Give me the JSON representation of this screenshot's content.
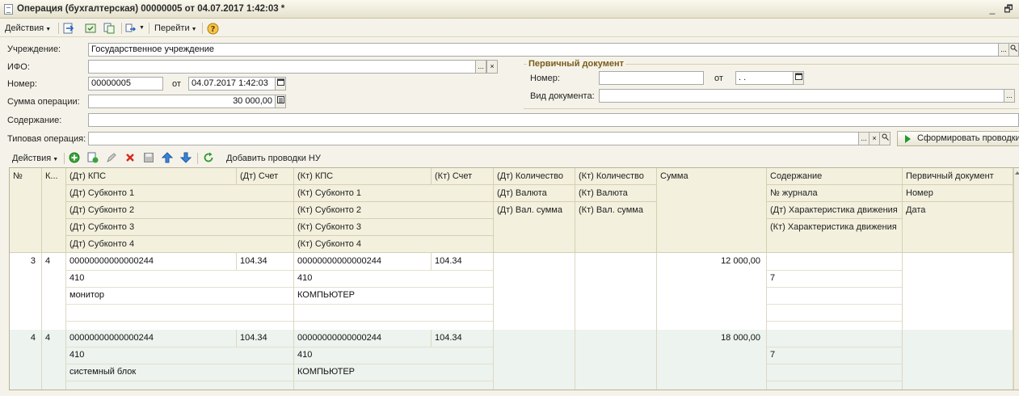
{
  "window": {
    "title": "Операция (бухгалтерская) 00000005 от 04.07.2017 1:42:03 *",
    "minimize": "_",
    "restore": "🗗"
  },
  "toolbar": {
    "actions": "Действия",
    "goto": "Перейти",
    "help": "?"
  },
  "form": {
    "institution_label": "Учреждение:",
    "institution_value": "Государственное учреждение",
    "ifo_label": "ИФО:",
    "number_label": "Номер:",
    "number_value": "00000005",
    "date_label": "от",
    "date_value": "04.07.2017  1:42:03",
    "sum_label": "Сумма операции:",
    "sum_value": "30 000,00",
    "content_label": "Содержание:",
    "typical_label": "Типовая операция:",
    "build_button": "Сформировать проводки",
    "ellipsis": "...",
    "clear": "×",
    "search": "🔍"
  },
  "primary_doc": {
    "title": "Первичный документ",
    "number_label": "Номер:",
    "date_label": "от",
    "date_value": " .  .",
    "doctype_label": "Вид документа:"
  },
  "grid_toolbar": {
    "actions": "Действия",
    "add_nu": "Добавить проводки НУ"
  },
  "table": {
    "headers": {
      "num": "№",
      "k": "К...",
      "dt_kps": "(Дт) КПС",
      "dt_account": "(Дт) Счет",
      "kt_kps": "(Кт) КПС",
      "kt_account": "(Кт) Счет",
      "dt_qty": "(Дт) Количество",
      "kt_qty": "(Кт) Количество",
      "sum": "Сумма",
      "content": "Содержание",
      "primary": "Первичный документ",
      "dt_sub1": "(Дт) Субконто 1",
      "kt_sub1": "(Кт) Субконто 1",
      "dt_cur": "(Дт) Валюта",
      "kt_cur": "(Кт) Валюта",
      "journal": "№ журнала",
      "prim_num": "Номер",
      "dt_sub2": "(Дт) Субконто 2",
      "kt_sub2": "(Кт) Субконто 2",
      "dt_valsum": "(Дт) Вал. сумма",
      "kt_valsum": "(Кт) Вал. сумма",
      "dt_char": "(Дт) Характеристика движения",
      "prim_date": "Дата",
      "dt_sub3": "(Дт) Субконто 3",
      "kt_sub3": "(Кт) Субконто 3",
      "kt_char": "(Кт) Характеристика движения",
      "dt_sub4": "(Дт) Субконто 4",
      "kt_sub4": "(Кт) Субконто 4"
    },
    "rows": [
      {
        "num": "3",
        "k": "4",
        "dt_kps": "00000000000000244",
        "dt_account": "104.34",
        "kt_kps": "00000000000000244",
        "kt_account": "104.34",
        "sum": "12 000,00",
        "dt_sub1": "410",
        "kt_sub1": "410",
        "journal": "7",
        "dt_sub2": "монитор",
        "kt_sub2": "КОМПЬЮТЕР"
      },
      {
        "num": "4",
        "k": "4",
        "dt_kps": "00000000000000244",
        "dt_account": "104.34",
        "kt_kps": "00000000000000244",
        "kt_account": "104.34",
        "sum": "18 000,00",
        "dt_sub1": "410",
        "kt_sub1": "410",
        "journal": "7",
        "dt_sub2": "системный блок",
        "kt_sub2": "КОМПЬЮТЕР"
      }
    ]
  }
}
